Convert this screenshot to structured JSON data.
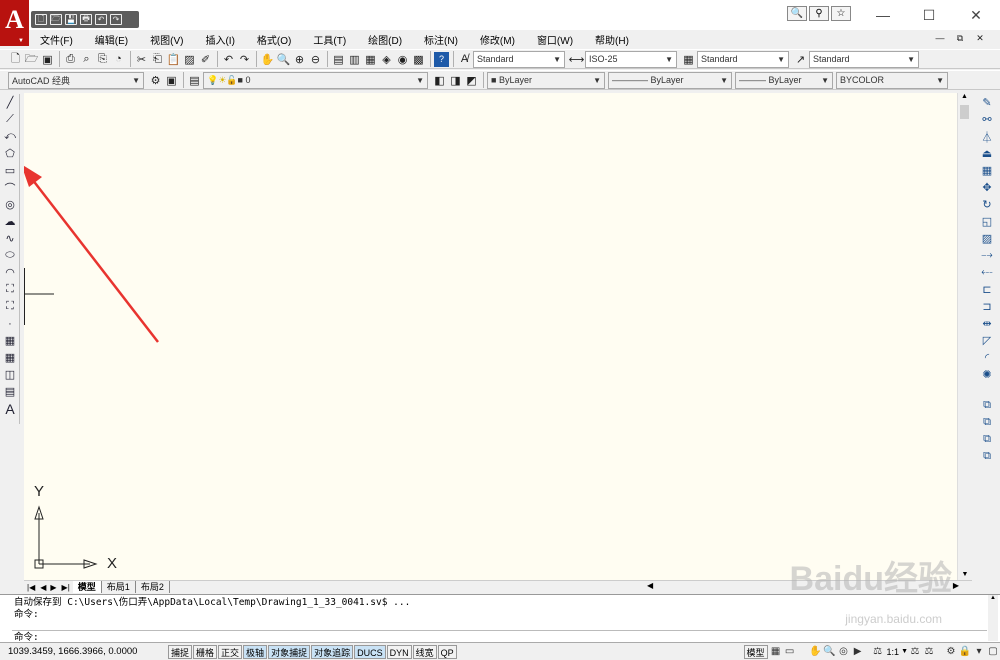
{
  "app": {
    "logo": "A",
    "title_controls": [
      "—",
      "☐",
      "✕"
    ]
  },
  "quick_access": [
    "🗋",
    "🗁",
    "💾",
    "🖶",
    "↶",
    "↷"
  ],
  "infocenter": [
    "🔍",
    "⚲",
    "☆"
  ],
  "menubar": [
    "文件(F)",
    "编辑(E)",
    "视图(V)",
    "插入(I)",
    "格式(O)",
    "工具(T)",
    "绘图(D)",
    "标注(N)",
    "修改(M)",
    "窗口(W)",
    "帮助(H)"
  ],
  "mdi_controls": [
    "—",
    "⧉",
    "✕"
  ],
  "styles": {
    "text_style": "Standard",
    "dim_style": "ISO-25",
    "table_style": "Standard",
    "multileader_style": "Standard"
  },
  "workspace": {
    "name": "AutoCAD 经典"
  },
  "layer": {
    "name": "0"
  },
  "properties": {
    "color": "ByLayer",
    "linetype": "ByLayer",
    "lineweight": "ByLayer",
    "plotstyle": "BYCOLOR"
  },
  "left_tools": [
    "╱",
    "⟋",
    "⤺",
    "⬠",
    "▭",
    "⌒",
    "◎",
    "☁",
    "∿",
    "⬭",
    "◠",
    "⛶",
    "⛶",
    "·",
    "▦",
    "▦",
    "◫",
    "▤",
    "A"
  ],
  "right_tools": [
    "✎",
    "⚯",
    "⏃",
    "⏏",
    "▦",
    "✥",
    "↻",
    "◱",
    "▨",
    "⤍",
    "⤎",
    "⊏",
    "⊐",
    "⇹",
    "◸",
    "◜",
    "✺",
    "⧉",
    "⧉",
    "⧉",
    "⧉"
  ],
  "ucs": {
    "x_label": "X",
    "y_label": "Y"
  },
  "layout_tabs": [
    "模型",
    "布局1",
    "布局2"
  ],
  "command": {
    "history": "自动保存到 C:\\Users\\伤口弄\\AppData\\Local\\Temp\\Drawing1_1_33_0041.sv$ ...",
    "prev_prompt": "命令:",
    "prompt": "命令:"
  },
  "status": {
    "coords": "1039.3459, 1666.3966, 0.0000",
    "toggles": [
      {
        "label": "捕捉",
        "on": false
      },
      {
        "label": "栅格",
        "on": false
      },
      {
        "label": "正交",
        "on": false
      },
      {
        "label": "极轴",
        "on": true
      },
      {
        "label": "对象捕捉",
        "on": true
      },
      {
        "label": "对象追踪",
        "on": true
      },
      {
        "label": "DUCS",
        "on": true
      },
      {
        "label": "DYN",
        "on": false
      },
      {
        "label": "线宽",
        "on": false
      },
      {
        "label": "QP",
        "on": false
      }
    ],
    "space": "模型",
    "annotation_scale": "1:1"
  },
  "watermark": {
    "text": "Baidu经验",
    "sub": "jingyan.baidu.com"
  },
  "colors": {
    "accent": "#b8120f",
    "canvas": "#fffdf2",
    "arrow": "#e8342f"
  }
}
